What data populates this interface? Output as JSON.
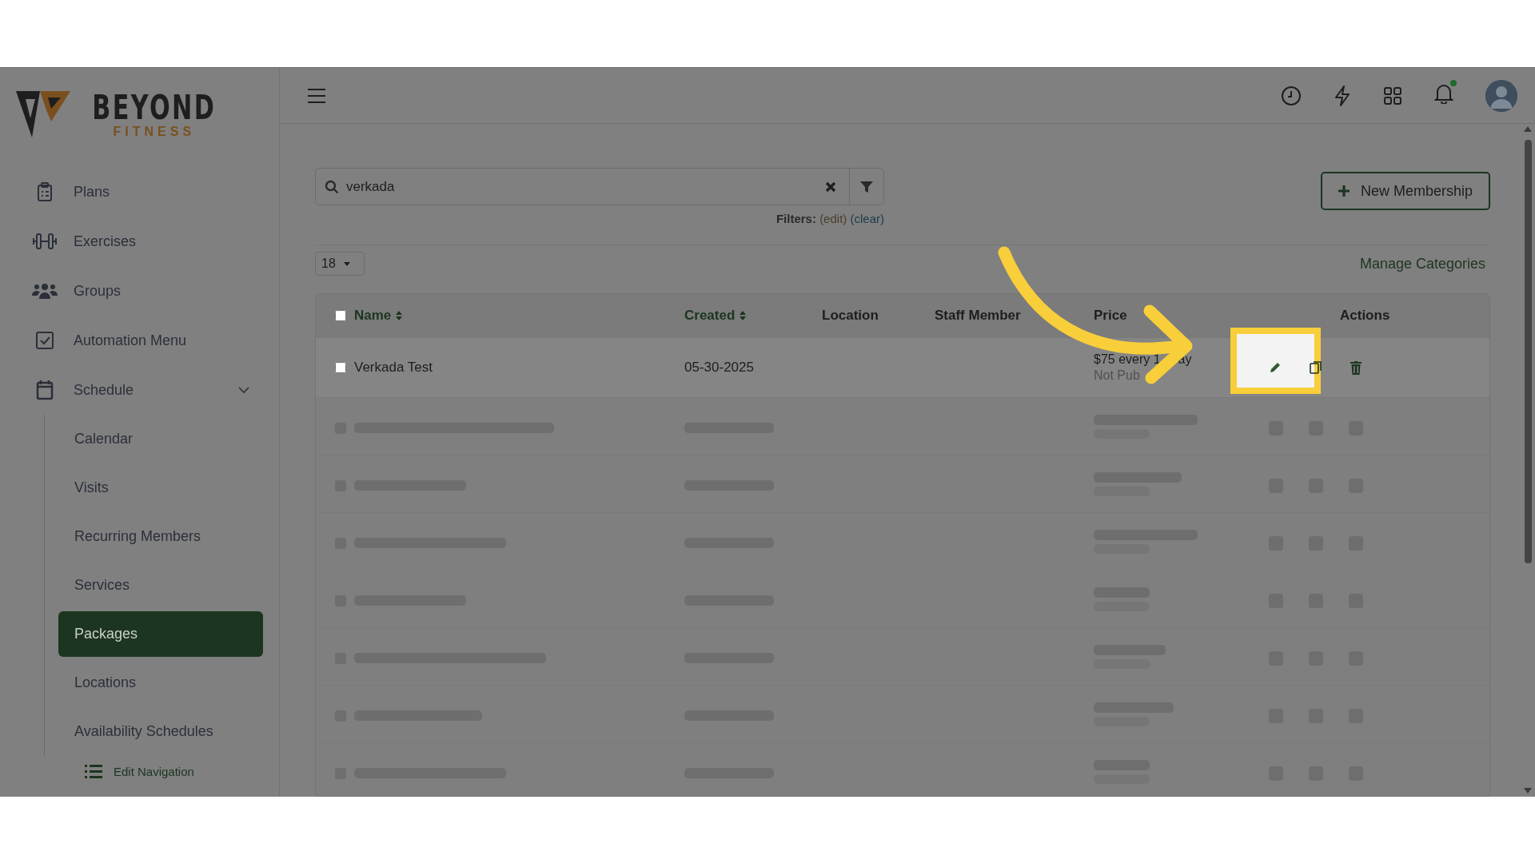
{
  "logo": {
    "name": "BEYOND",
    "tagline": "FITNESS"
  },
  "sidebar": {
    "items": [
      {
        "label": "Plans",
        "selected": false
      },
      {
        "label": "Exercises",
        "selected": false
      },
      {
        "label": "Groups",
        "selected": false
      },
      {
        "label": "Automation Menu",
        "selected": false
      },
      {
        "label": "Schedule",
        "selected": false,
        "expanded": true,
        "children": [
          {
            "label": "Calendar",
            "selected": false
          },
          {
            "label": "Visits",
            "selected": false
          },
          {
            "label": "Recurring Members",
            "selected": false
          },
          {
            "label": "Services",
            "selected": false
          },
          {
            "label": "Packages",
            "selected": true
          },
          {
            "label": "Locations",
            "selected": false
          },
          {
            "label": "Availability Schedules",
            "selected": false
          }
        ]
      }
    ],
    "edit_navigation": "Edit Navigation"
  },
  "header": {
    "notifications_unread": true
  },
  "search": {
    "value": "verkada"
  },
  "filters": {
    "label": "Filters:",
    "edit": "(edit)",
    "clear": "(clear)"
  },
  "new_button": "New Membership",
  "page_size": "18",
  "manage_categories": "Manage Categories",
  "table": {
    "select_all_checked": false,
    "columns": [
      {
        "label": "Name",
        "sortable": true
      },
      {
        "label": "Created",
        "sortable": true
      },
      {
        "label": "Location",
        "sortable": false
      },
      {
        "label": "Staff Member",
        "sortable": false
      },
      {
        "label": "Price",
        "sortable": false
      },
      {
        "label": "Actions",
        "sortable": false
      }
    ],
    "rows": [
      {
        "name": "Verkada Test",
        "created": "05-30-2025",
        "price": "$75 every 1",
        "price_tail": "ay",
        "status": "Not Pub",
        "checked": false
      }
    ]
  }
}
